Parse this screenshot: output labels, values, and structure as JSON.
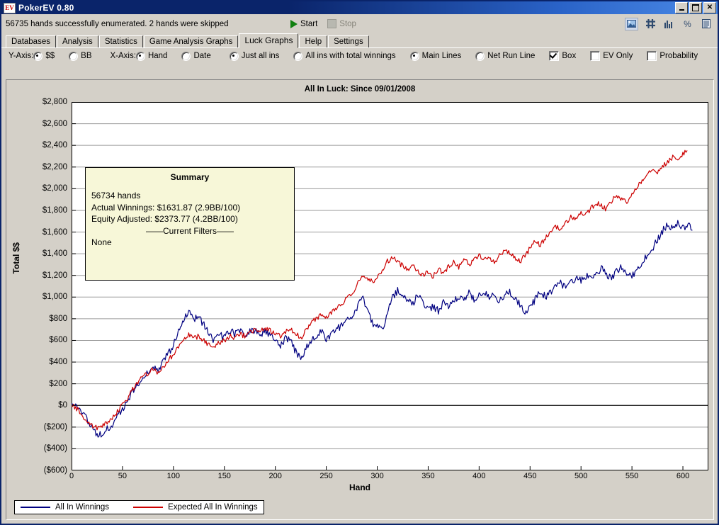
{
  "window": {
    "title": "PokerEV 0.80",
    "icon": "EV",
    "minimize": "minimize-icon",
    "maximize": "maximize-icon",
    "close": "close-icon"
  },
  "status": {
    "message": "56735 hands successfully enumerated. 2 hands were skipped",
    "start_label": "Start",
    "stop_label": "Stop"
  },
  "toolbar_icons": [
    {
      "name": "image-icon",
      "selected": true
    },
    {
      "name": "grid-icon",
      "selected": false
    },
    {
      "name": "bar-chart-icon",
      "selected": false
    },
    {
      "name": "percent-icon",
      "selected": false
    },
    {
      "name": "list-icon",
      "selected": false
    }
  ],
  "tabs": [
    {
      "label": "Databases",
      "active": false
    },
    {
      "label": "Analysis",
      "active": false
    },
    {
      "label": "Statistics",
      "active": false
    },
    {
      "label": "Game Analysis Graphs",
      "active": false
    },
    {
      "label": "Luck Graphs",
      "active": true
    },
    {
      "label": "Help",
      "active": false
    },
    {
      "label": "Settings",
      "active": false
    }
  ],
  "options": {
    "yaxis_label": "Y-Axis:",
    "yaxis_dollar": "$$",
    "yaxis_bb": "BB",
    "xaxis_label": "X-Axis:",
    "xaxis_hand": "Hand",
    "xaxis_date": "Date",
    "just_all_ins": "Just all ins",
    "all_ins_total": "All ins with total winnings",
    "main_lines": "Main Lines",
    "net_run_line": "Net Run Line",
    "box": "Box",
    "ev_only": "EV Only",
    "probability": "Probability",
    "selected": {
      "yaxis": "$$",
      "xaxis": "Hand",
      "ins_mode": "Just all ins",
      "line_mode": "Main Lines",
      "box": true,
      "ev_only": false,
      "probability": false
    }
  },
  "summary": {
    "heading": "Summary",
    "hands": "56734 hands",
    "actual": "Actual Winnings: $1631.87 (2.9BB/100)",
    "equity": "Equity Adjusted: $2373.77 (4.2BB/100)",
    "filters_header": "——Current Filters——",
    "filters_value": "None"
  },
  "colors": {
    "actual_line": "#000080",
    "expected_line": "#cc0000",
    "plot_bg": "#ffffff",
    "panel_bg": "#d4d0c8",
    "summary_bg": "#f7f7d8",
    "grid": "#9a9a9a",
    "titlebar": "#0a246a"
  },
  "chart_data": {
    "type": "line",
    "title": "All In Luck: Since 09/01/2008",
    "xlabel": "Hand",
    "ylabel": "Total $$",
    "xlim": [
      0,
      625
    ],
    "ylim": [
      -600,
      2800
    ],
    "ytick_step": 200,
    "xtick_step": 50,
    "grid": true,
    "legend_position": "bottom-left",
    "yticks": [
      "$2,800",
      "$2,600",
      "$2,400",
      "$2,200",
      "$2,000",
      "$1,800",
      "$1,600",
      "$1,400",
      "$1,200",
      "$1,000",
      "$800",
      "$600",
      "$400",
      "$200",
      "$0",
      "($200)",
      "($400)",
      "($600)"
    ],
    "ytick_values": [
      2800,
      2600,
      2400,
      2200,
      2000,
      1800,
      1600,
      1400,
      1200,
      1000,
      800,
      600,
      400,
      200,
      0,
      -200,
      -400,
      -600
    ],
    "xticks": [
      "0",
      "50",
      "100",
      "150",
      "200",
      "250",
      "300",
      "350",
      "400",
      "450",
      "500",
      "550",
      "600"
    ],
    "xtick_values": [
      0,
      50,
      100,
      150,
      200,
      250,
      300,
      350,
      400,
      450,
      500,
      550,
      600
    ],
    "series": [
      {
        "name": "All In Winnings",
        "color": "#000080",
        "x": [
          0,
          5,
          10,
          15,
          20,
          25,
          30,
          35,
          40,
          45,
          50,
          55,
          60,
          65,
          70,
          75,
          80,
          85,
          90,
          95,
          100,
          105,
          110,
          115,
          120,
          125,
          130,
          135,
          140,
          145,
          150,
          155,
          160,
          165,
          170,
          175,
          180,
          185,
          190,
          195,
          200,
          205,
          210,
          215,
          220,
          225,
          230,
          235,
          240,
          245,
          250,
          255,
          260,
          265,
          270,
          275,
          280,
          285,
          290,
          295,
          300,
          305,
          310,
          315,
          320,
          325,
          330,
          335,
          340,
          345,
          350,
          355,
          360,
          365,
          370,
          375,
          380,
          385,
          390,
          395,
          400,
          405,
          410,
          415,
          420,
          425,
          430,
          435,
          440,
          445,
          450,
          455,
          460,
          465,
          470,
          475,
          480,
          485,
          490,
          495,
          500,
          505,
          510,
          515,
          520,
          525,
          530,
          535,
          540,
          545,
          550,
          555,
          560,
          565,
          570,
          575,
          580,
          585,
          590,
          595,
          600,
          605,
          610,
          615,
          620,
          625
        ],
        "y": [
          0,
          -20,
          -60,
          -130,
          -200,
          -290,
          -250,
          -210,
          -180,
          -100,
          -40,
          40,
          130,
          190,
          260,
          310,
          370,
          330,
          420,
          480,
          560,
          700,
          790,
          860,
          800,
          820,
          740,
          660,
          600,
          650,
          630,
          690,
          660,
          700,
          640,
          680,
          700,
          650,
          690,
          640,
          600,
          560,
          620,
          590,
          500,
          430,
          520,
          600,
          640,
          680,
          620,
          660,
          700,
          740,
          780,
          820,
          900,
          1010,
          880,
          760,
          720,
          690,
          850,
          1000,
          1060,
          1010,
          980,
          940,
          1020,
          960,
          880,
          920,
          870,
          950,
          900,
          960,
          1010,
          950,
          1040,
          980,
          1010,
          1050,
          990,
          1020,
          960,
          1010,
          1050,
          1000,
          940,
          870,
          900,
          980,
          1060,
          1000,
          1040,
          1090,
          1130,
          1080,
          1140,
          1180,
          1150,
          1200,
          1170,
          1230,
          1260,
          1210,
          1180,
          1240,
          1280,
          1230,
          1190,
          1260,
          1320,
          1380,
          1450,
          1530,
          1610,
          1660,
          1630,
          1680,
          1640,
          1660,
          1620
        ]
      },
      {
        "name": "Expected All In Winnings",
        "color": "#cc0000",
        "x": [
          0,
          5,
          10,
          15,
          20,
          25,
          30,
          35,
          40,
          45,
          50,
          55,
          60,
          65,
          70,
          75,
          80,
          85,
          90,
          95,
          100,
          105,
          110,
          115,
          120,
          125,
          130,
          135,
          140,
          145,
          150,
          155,
          160,
          165,
          170,
          175,
          180,
          185,
          190,
          195,
          200,
          205,
          210,
          215,
          220,
          225,
          230,
          235,
          240,
          245,
          250,
          255,
          260,
          265,
          270,
          275,
          280,
          285,
          290,
          295,
          300,
          305,
          310,
          315,
          320,
          325,
          330,
          335,
          340,
          345,
          350,
          355,
          360,
          365,
          370,
          375,
          380,
          385,
          390,
          395,
          400,
          405,
          410,
          415,
          420,
          425,
          430,
          435,
          440,
          445,
          450,
          455,
          460,
          465,
          470,
          475,
          480,
          485,
          490,
          495,
          500,
          505,
          510,
          515,
          520,
          525,
          530,
          535,
          540,
          545,
          550,
          555,
          560,
          565,
          570,
          575,
          580,
          585,
          590,
          595,
          600,
          605,
          610,
          615,
          620,
          625
        ],
        "y": [
          0,
          -30,
          -90,
          -160,
          -190,
          -210,
          -180,
          -150,
          -120,
          -60,
          10,
          70,
          150,
          210,
          270,
          300,
          340,
          300,
          360,
          420,
          470,
          540,
          600,
          650,
          620,
          640,
          600,
          560,
          530,
          580,
          600,
          640,
          620,
          660,
          640,
          680,
          700,
          680,
          710,
          690,
          660,
          640,
          680,
          700,
          660,
          620,
          700,
          760,
          800,
          840,
          820,
          860,
          900,
          940,
          980,
          1020,
          1100,
          1210,
          1180,
          1140,
          1180,
          1240,
          1330,
          1370,
          1320,
          1290,
          1260,
          1300,
          1240,
          1200,
          1230,
          1190,
          1260,
          1220,
          1280,
          1330,
          1280,
          1360,
          1300,
          1340,
          1390,
          1340,
          1370,
          1320,
          1380,
          1440,
          1400,
          1370,
          1330,
          1380,
          1450,
          1520,
          1480,
          1540,
          1600,
          1660,
          1620,
          1680,
          1740,
          1720,
          1780,
          1760,
          1820,
          1870,
          1840,
          1810,
          1880,
          1940,
          1900,
          1870,
          1950,
          2020,
          2080,
          2140,
          2190,
          2160,
          2200,
          2250,
          2290,
          2260,
          2320,
          2380
        ]
      }
    ]
  },
  "legend": [
    {
      "label": "All In Winnings",
      "color": "#000080"
    },
    {
      "label": "Expected All In Winnings",
      "color": "#cc0000"
    }
  ]
}
